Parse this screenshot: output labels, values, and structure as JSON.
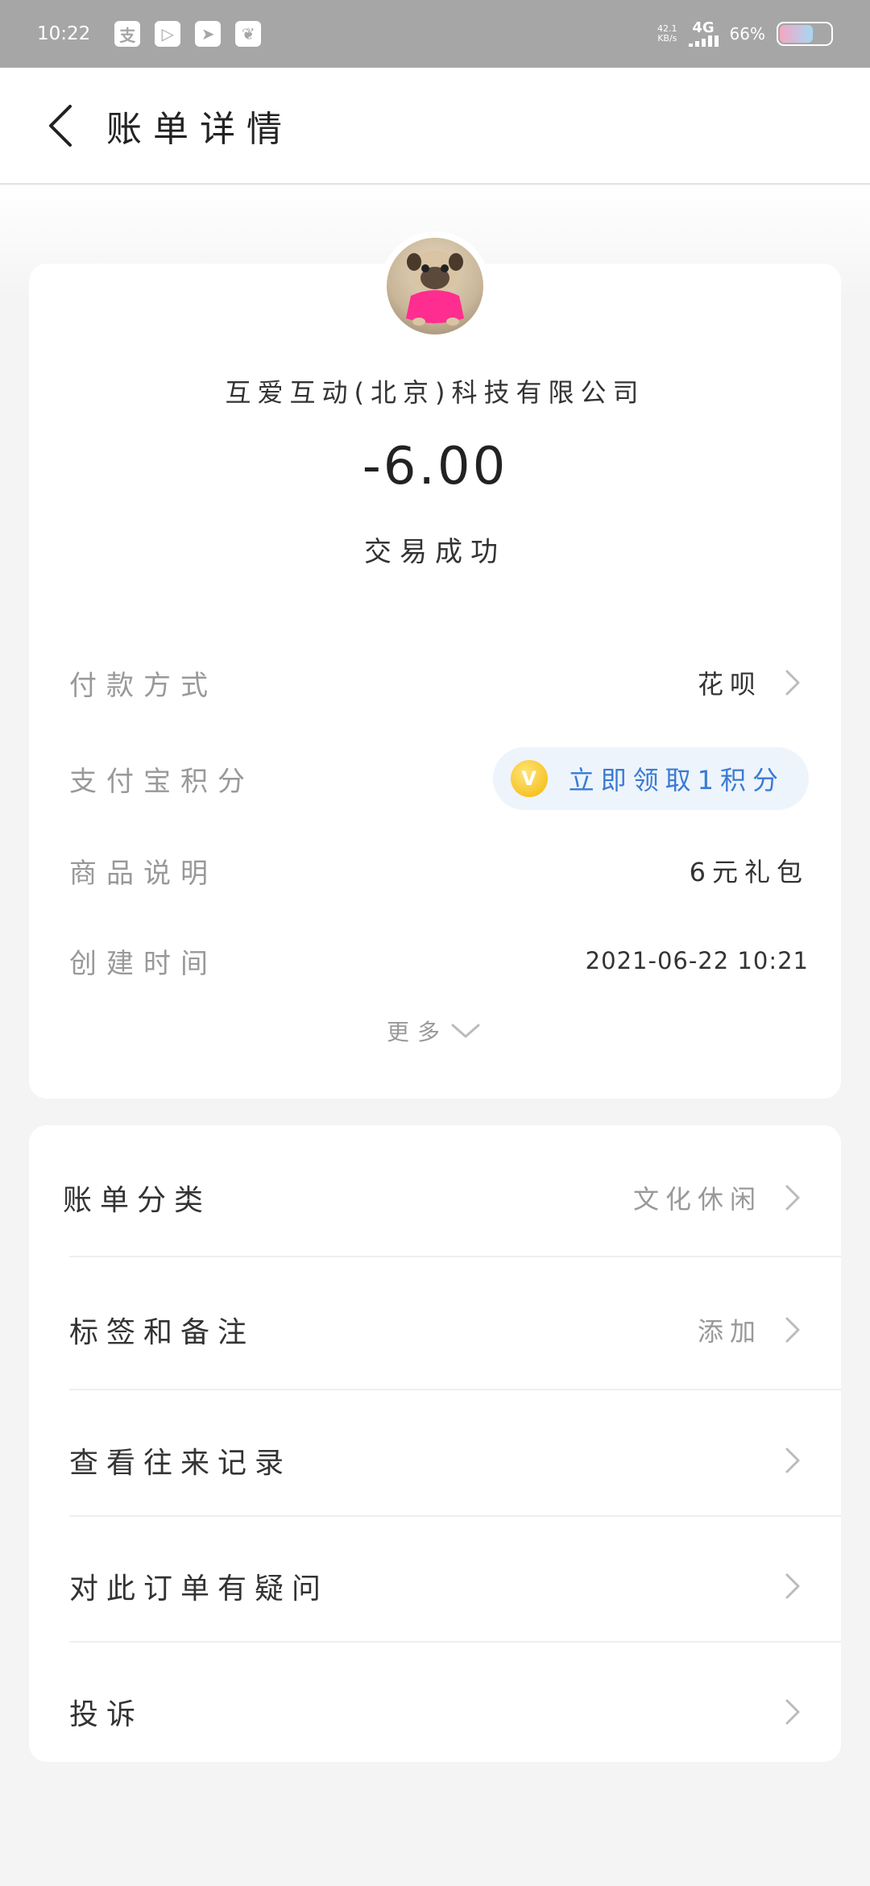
{
  "status_bar": {
    "time": "10:22",
    "app_icons": [
      "支",
      "▷",
      "➤",
      "❦"
    ],
    "net_speed_value": "42.1",
    "net_speed_unit": "KB/s",
    "network": "4G",
    "battery_percent": "66%",
    "battery_level": 0.66
  },
  "header": {
    "title": "账单详情"
  },
  "summary": {
    "merchant": "互爱互动(北京)科技有限公司",
    "amount": "-6.00",
    "status": "交易成功"
  },
  "details": {
    "payment_method_label": "付款方式",
    "payment_method_value": "花呗",
    "points_label": "支付宝积分",
    "points_button": "立即领取1积分",
    "points_coin": "V",
    "product_label": "商品说明",
    "product_value": "6元礼包",
    "created_label": "创建时间",
    "created_value": "2021-06-22 10:21",
    "more_label": "更多"
  },
  "list": {
    "category_label": "账单分类",
    "category_value": "文化休闲",
    "tag_label": "标签和备注",
    "tag_value": "添加",
    "history_label": "查看往来记录",
    "question_label": "对此订单有疑问",
    "complaint_label": "投诉"
  },
  "colors": {
    "status_bar": "#a6a6a6",
    "accent_blue": "#3a7bd5",
    "pill_bg": "#eef4fb",
    "coin": "#f2b705",
    "label_gray": "#999999"
  }
}
